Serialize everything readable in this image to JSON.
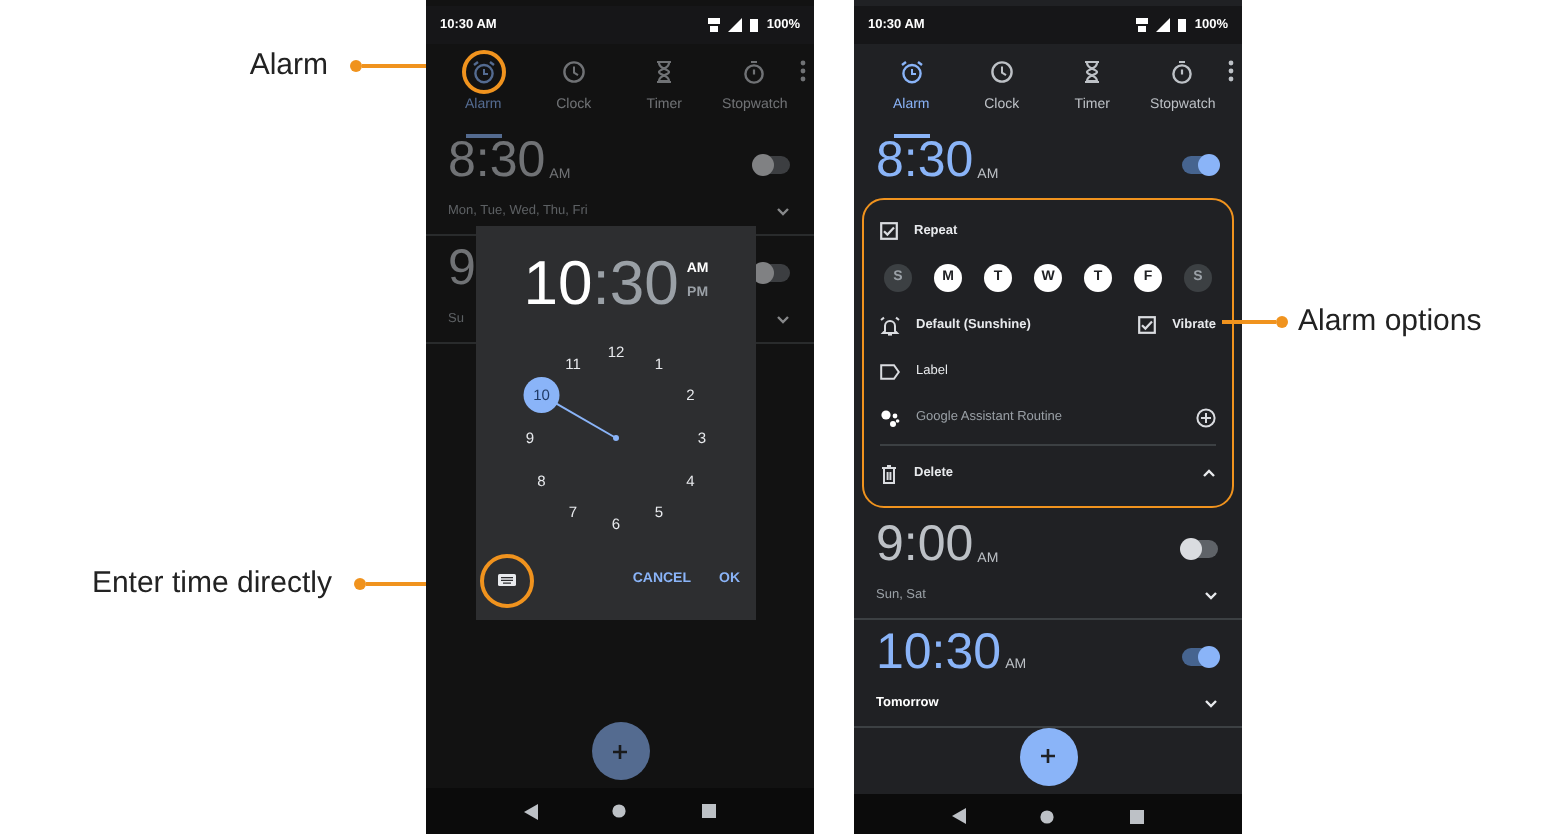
{
  "left_callouts": [
    {
      "label": "Alarm"
    },
    {
      "label": "Enter time directly"
    }
  ],
  "right_callouts": [
    {
      "label": "Alarm options"
    }
  ],
  "phones": [
    {
      "dimmed": true,
      "status_bar": {
        "time": "10:30 AM",
        "battery": "100%"
      },
      "tabs": [
        {
          "label": "Alarm",
          "selected": true,
          "highlighted": true
        },
        {
          "label": "Clock",
          "selected": false,
          "highlighted": false
        },
        {
          "label": "Timer",
          "selected": false,
          "highlighted": false
        },
        {
          "label": "Stopwatch",
          "selected": false,
          "highlighted": false
        }
      ],
      "alarms": [
        {
          "time": "8:30",
          "period": "AM",
          "on": false,
          "expanded": false,
          "summary": "Mon, Tue, Wed, Thu, Fri"
        },
        {
          "time": "9",
          "on": false,
          "expanded": false,
          "summary": "Su"
        }
      ],
      "time_picker": {
        "hour": {
          "text": "10",
          "selected": true
        },
        "separator": ":",
        "minute": {
          "text": "30",
          "selected": false
        },
        "periods": [
          {
            "label": "AM",
            "selected": true
          },
          {
            "label": "PM",
            "selected": false
          }
        ],
        "dial": [
          {
            "label": "12",
            "selected": false
          },
          {
            "label": "1",
            "selected": false
          },
          {
            "label": "2",
            "selected": false
          },
          {
            "label": "3",
            "selected": false
          },
          {
            "label": "4",
            "selected": false
          },
          {
            "label": "5",
            "selected": false
          },
          {
            "label": "6",
            "selected": false
          },
          {
            "label": "7",
            "selected": false
          },
          {
            "label": "8",
            "selected": false
          },
          {
            "label": "9",
            "selected": false
          },
          {
            "label": "10",
            "selected": true
          },
          {
            "label": "11",
            "selected": false
          }
        ],
        "keyboard_highlighted": true,
        "cancel": "CANCEL",
        "ok": "OK"
      }
    },
    {
      "dimmed": false,
      "status_bar": {
        "time": "10:30 AM",
        "battery": "100%"
      },
      "tabs": [
        {
          "label": "Alarm",
          "selected": true,
          "highlighted": false
        },
        {
          "label": "Clock",
          "selected": false,
          "highlighted": false
        },
        {
          "label": "Timer",
          "selected": false,
          "highlighted": false
        },
        {
          "label": "Stopwatch",
          "selected": false,
          "highlighted": false
        }
      ],
      "alarms": [
        {
          "time": "8:30",
          "period": "AM",
          "on": true,
          "expanded": true,
          "options": {
            "highlighted": true,
            "repeat": {
              "label": "Repeat",
              "checked": true
            },
            "days": [
              {
                "letter": "S",
                "selected": false
              },
              {
                "letter": "M",
                "selected": true
              },
              {
                "letter": "T",
                "selected": true
              },
              {
                "letter": "W",
                "selected": true
              },
              {
                "letter": "T",
                "selected": true
              },
              {
                "letter": "F",
                "selected": true
              },
              {
                "letter": "S",
                "selected": false
              }
            ],
            "ringtone": "Default (Sunshine)",
            "vibrate": {
              "label": "Vibrate",
              "checked": true
            },
            "label": "Label",
            "routine": "Google Assistant Routine",
            "delete": "Delete"
          }
        },
        {
          "time": "9:00",
          "period": "AM",
          "on": false,
          "expanded": false,
          "summary": "Sun, Sat"
        },
        {
          "time": "10:30",
          "period": "AM",
          "on": true,
          "expanded": false,
          "summary": "Tomorrow"
        }
      ]
    }
  ]
}
